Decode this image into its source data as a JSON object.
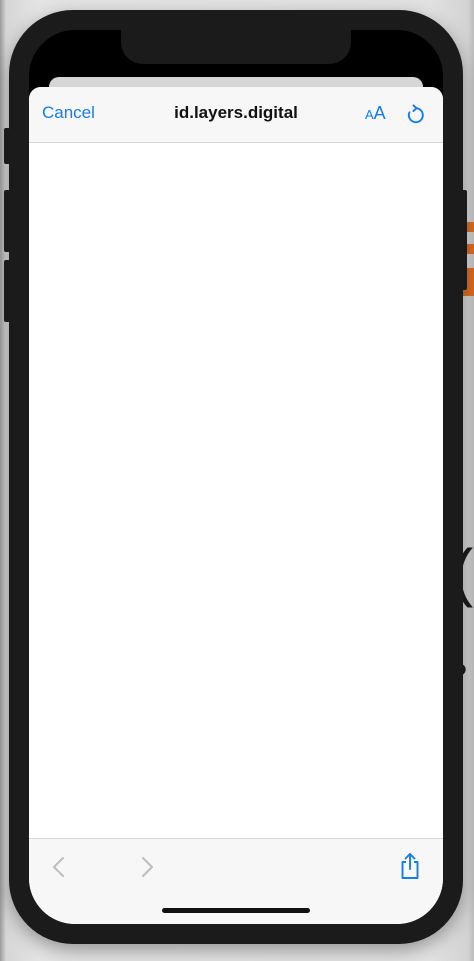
{
  "browser_sheet": {
    "cancel_label": "Cancel",
    "title": "id.layers.digital",
    "text_size_small": "A",
    "text_size_large": "A",
    "accent_color": "#147de8",
    "disabled_color": "#bdbdc2"
  },
  "icons": {
    "reload": "reload-icon",
    "back": "chevron-left-icon",
    "forward": "chevron-right-icon",
    "share": "share-icon"
  },
  "toolbar": {
    "back_enabled": false,
    "forward_enabled": false
  }
}
